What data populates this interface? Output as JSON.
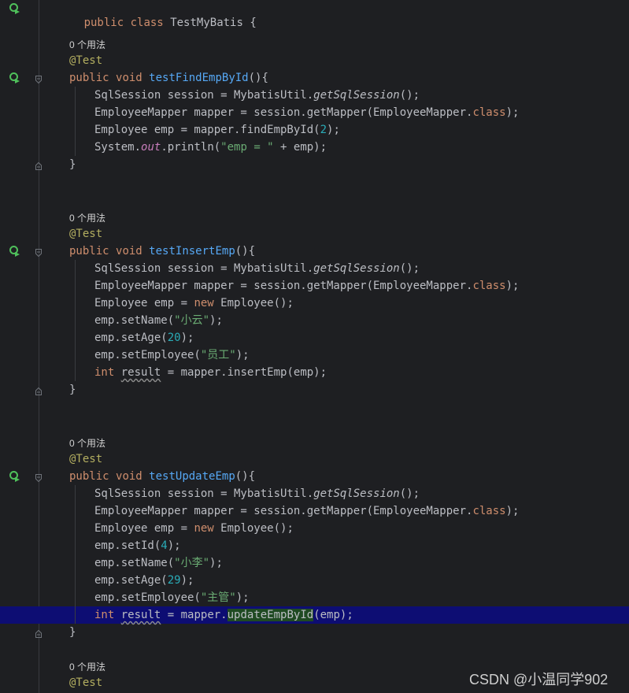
{
  "editor": {
    "class_decl": {
      "kw1": "public",
      "kw2": "class",
      "name": "TestMyBatis",
      "brace": " {"
    },
    "usage_hint": "0 个用法",
    "annotation": "@Test",
    "close_brace": "}",
    "methods": [
      {
        "kw1": "public",
        "kw2": "void",
        "name": "testFindEmpById",
        "sig_tail": "(){",
        "body": [
          {
            "parts": [
              {
                "t": "SqlSession session = MybatisUtil."
              },
              {
                "t": "getSqlSession",
                "c": "it"
              },
              {
                "t": "();"
              }
            ]
          },
          {
            "parts": [
              {
                "t": "EmployeeMapper mapper = session.getMapper(EmployeeMapper."
              },
              {
                "t": "class",
                "c": "kw"
              },
              {
                "t": ");"
              }
            ]
          },
          {
            "parts": [
              {
                "t": "Employee emp = mapper.findEmpById("
              },
              {
                "t": "2",
                "c": "num"
              },
              {
                "t": ");"
              }
            ]
          },
          {
            "parts": [
              {
                "t": "System."
              },
              {
                "t": "out",
                "c": "fld"
              },
              {
                "t": ".println("
              },
              {
                "t": "\"emp = \"",
                "c": "st"
              },
              {
                "t": " + emp);"
              }
            ]
          }
        ]
      },
      {
        "kw1": "public",
        "kw2": "void",
        "name": "testInsertEmp",
        "sig_tail": "(){",
        "body": [
          {
            "parts": [
              {
                "t": "SqlSession session = MybatisUtil."
              },
              {
                "t": "getSqlSession",
                "c": "it"
              },
              {
                "t": "();"
              }
            ]
          },
          {
            "parts": [
              {
                "t": "EmployeeMapper mapper = session.getMapper(EmployeeMapper."
              },
              {
                "t": "class",
                "c": "kw"
              },
              {
                "t": ");"
              }
            ]
          },
          {
            "parts": [
              {
                "t": "Employee emp = "
              },
              {
                "t": "new",
                "c": "kw"
              },
              {
                "t": " Employee();"
              }
            ]
          },
          {
            "parts": [
              {
                "t": "emp.setName("
              },
              {
                "t": "\"小云\"",
                "c": "st"
              },
              {
                "t": ");"
              }
            ]
          },
          {
            "parts": [
              {
                "t": "emp.setAge("
              },
              {
                "t": "20",
                "c": "num"
              },
              {
                "t": ");"
              }
            ]
          },
          {
            "parts": [
              {
                "t": "emp.setEmployee("
              },
              {
                "t": "\"员工\"",
                "c": "st"
              },
              {
                "t": ");"
              }
            ]
          },
          {
            "parts": [
              {
                "t": "int",
                "c": "kw"
              },
              {
                "t": " "
              },
              {
                "t": "result",
                "c": "warn"
              },
              {
                "t": " = mapper.insertEmp(emp);"
              }
            ]
          }
        ]
      },
      {
        "kw1": "public",
        "kw2": "void",
        "name": "testUpdateEmp",
        "sig_tail": "(){",
        "body": [
          {
            "parts": [
              {
                "t": "SqlSession session = MybatisUtil."
              },
              {
                "t": "getSqlSession",
                "c": "it"
              },
              {
                "t": "();"
              }
            ]
          },
          {
            "parts": [
              {
                "t": "EmployeeMapper mapper = session.getMapper(EmployeeMapper."
              },
              {
                "t": "class",
                "c": "kw"
              },
              {
                "t": ");"
              }
            ]
          },
          {
            "parts": [
              {
                "t": "Employee emp = "
              },
              {
                "t": "new",
                "c": "kw"
              },
              {
                "t": " Employee();"
              }
            ]
          },
          {
            "parts": [
              {
                "t": "emp.setId("
              },
              {
                "t": "4",
                "c": "num"
              },
              {
                "t": ");"
              }
            ]
          },
          {
            "parts": [
              {
                "t": "emp.setName("
              },
              {
                "t": "\"小李\"",
                "c": "st"
              },
              {
                "t": ");"
              }
            ]
          },
          {
            "parts": [
              {
                "t": "emp.setAge("
              },
              {
                "t": "29",
                "c": "num"
              },
              {
                "t": ");"
              }
            ]
          },
          {
            "parts": [
              {
                "t": "emp.setEmployee("
              },
              {
                "t": "\"主管\"",
                "c": "st"
              },
              {
                "t": ");"
              }
            ]
          },
          {
            "parts": [
              {
                "t": "int",
                "c": "kw"
              },
              {
                "t": " "
              },
              {
                "t": "result",
                "c": "warn"
              },
              {
                "t": " = mapper."
              },
              {
                "t": "updateEmpById",
                "c": "match"
              },
              {
                "t": "(emp);"
              }
            ],
            "highlighted": true
          }
        ]
      }
    ]
  },
  "watermark": "CSDN @小温同学902",
  "colors": {
    "background": "#1e1f22",
    "keyword": "#cf8e6d",
    "annotation": "#b3ae60",
    "method_name": "#56a8f5",
    "string": "#6aab73",
    "number": "#2aacb8",
    "static_field": "#c77dbb",
    "current_line": "#0d0d73",
    "run_icon": "#4fc05b"
  },
  "icons": {
    "run": "run-test-icon",
    "fold": "fold-marker-icon"
  }
}
